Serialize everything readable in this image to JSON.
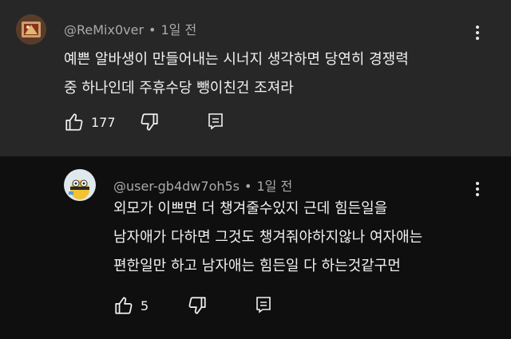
{
  "comments": [
    {
      "author": "@ReMix0ver",
      "separator": "•",
      "time": "1일 전",
      "lines": [
        "예쁜 알바생이 만들어내는 시너지 생각하면 당연히 경쟁력",
        "중 하나인데 주휴수당 뺑이친건 조져라"
      ],
      "likes": "177",
      "icons": {
        "like": "thumb-up-icon",
        "dislike": "thumb-down-icon",
        "reply": "reply-icon",
        "more": "more-vert-icon"
      }
    },
    {
      "author": "@user-gb4dw7oh5s",
      "separator": "•",
      "time": "1일 전",
      "lines": [
        "외모가 이쁘면 더 챙겨줄수있지 근데 힘든일을",
        "남자애가 다하면 그것도 챙겨줘야하지않나 여자애는",
        "편한일만 하고 남자애는 힘든일 다 하는것같구먼"
      ],
      "likes": "5",
      "icons": {
        "like": "thumb-up-icon",
        "dislike": "thumb-down-icon",
        "reply": "reply-icon",
        "more": "more-vert-icon"
      }
    }
  ],
  "colors": {
    "top_bg": "#272727",
    "reply_bg": "#0f0f0f",
    "text": "#f1f1f1",
    "meta": "#aaaaaa"
  }
}
